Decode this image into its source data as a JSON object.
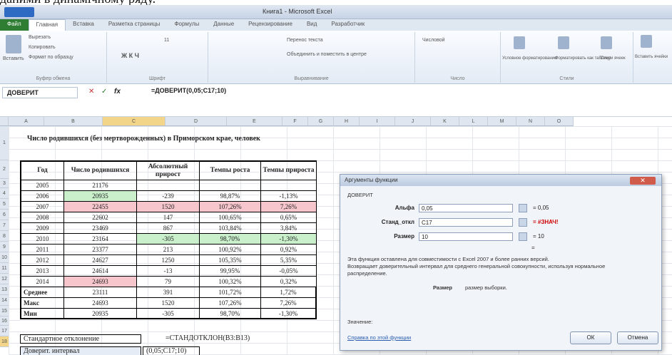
{
  "doc_heading": "даними в динамічному ряду.",
  "window": {
    "title": "Книга1 - Microsoft Excel"
  },
  "ribbon": {
    "tabs": [
      "Файл",
      "Главная",
      "Вставка",
      "Разметка страницы",
      "Формулы",
      "Данные",
      "Рецензирование",
      "Вид",
      "Разработчик"
    ],
    "groups": [
      "Буфер обмена",
      "Шрифт",
      "Выравнивание",
      "Число",
      "Стили"
    ],
    "clip_items": [
      "Вырезать",
      "Копировать",
      "Формат по образцу"
    ],
    "paste_label": "Вставить",
    "font_size": "11",
    "wrap_label": "Перенос текста",
    "merge_label": "Объединить и поместить в центре",
    "number_format": "Числовой",
    "style_buttons": [
      "Условное форматирование",
      "Форматировать как таблицу",
      "Стили ячеек"
    ],
    "insert_cells": "Вставить ячейки"
  },
  "formula_bar": {
    "name_box": "ДОВЕРИТ",
    "fx": "fx",
    "formula": "=ДОВЕРИТ(0,05;C17;10)"
  },
  "columns": [
    "A",
    "B",
    "C",
    "D",
    "E",
    "F",
    "G",
    "H",
    "I",
    "J",
    "K",
    "L",
    "M",
    "N",
    "O"
  ],
  "rows": [
    "1",
    "2",
    "3",
    "4",
    "5",
    "6",
    "7",
    "8",
    "9",
    "10",
    "11",
    "12",
    "13",
    "14",
    "15",
    "16",
    "17",
    "18"
  ],
  "sheet": {
    "title": "Число родившихся (без мертворожденных) в Приморском крае, человек",
    "headers": [
      "Год",
      "Число родившихся",
      "Абсолютный прирост",
      "Темпы роста",
      "Темпы прироста"
    ],
    "data": [
      [
        "2005",
        "21176",
        "",
        "",
        ""
      ],
      [
        "2006",
        "20935",
        "-239",
        "98,87%",
        "-1,13%"
      ],
      [
        "2007",
        "22455",
        "1520",
        "107,26%",
        "7,26%"
      ],
      [
        "2008",
        "22602",
        "147",
        "100,65%",
        "0,65%"
      ],
      [
        "2009",
        "23469",
        "867",
        "103,84%",
        "3,84%"
      ],
      [
        "2010",
        "23164",
        "-305",
        "98,70%",
        "-1,30%"
      ],
      [
        "2011",
        "23377",
        "213",
        "100,92%",
        "0,92%"
      ],
      [
        "2012",
        "24627",
        "1250",
        "105,35%",
        "5,35%"
      ],
      [
        "2013",
        "24614",
        "-13",
        "99,95%",
        "-0,05%"
      ],
      [
        "2014",
        "24693",
        "79",
        "100,32%",
        "0,32%"
      ]
    ],
    "summary": [
      [
        "Среднее",
        "23111",
        "391",
        "101,72%",
        "1,72%"
      ],
      [
        "Макс",
        "24693",
        "1520",
        "107,26%",
        "7,26%"
      ],
      [
        "Мин",
        "20935",
        "-305",
        "98,70%",
        "-1,30%"
      ]
    ],
    "stdev_label": "Стандартное отклонение",
    "stdev_formula": "=СТАНДОТКЛОН(B3:B13)",
    "conf_label": "Доверит. интервал",
    "conf_formula": "(0,05;C17;10)"
  },
  "dialog": {
    "title": "Аргументы функции",
    "func": "ДОВЕРИТ",
    "args": [
      {
        "label": "Альфа",
        "value": "0,05",
        "result": "= 0,05"
      },
      {
        "label": "Станд_откл",
        "value": "C17",
        "result": "= #ЗНАЧ!"
      },
      {
        "label": "Размер",
        "value": "10",
        "result": "= 10"
      }
    ],
    "eq": "=",
    "desc1": "Эта функция оставлена для совместимости с Excel 2007 и более ранних версий.",
    "desc2": "Возвращает доверительный интервал для среднего генеральной совокупности, используя нормальное",
    "desc3": "распределение.",
    "arg_help_label": "Размер",
    "arg_help": "размер выборки.",
    "value_label": "Значение:",
    "help_link": "Справка по этой функции",
    "ok": "ОК",
    "cancel": "Отмена",
    "colors": {
      "error": "#cc0000"
    }
  }
}
